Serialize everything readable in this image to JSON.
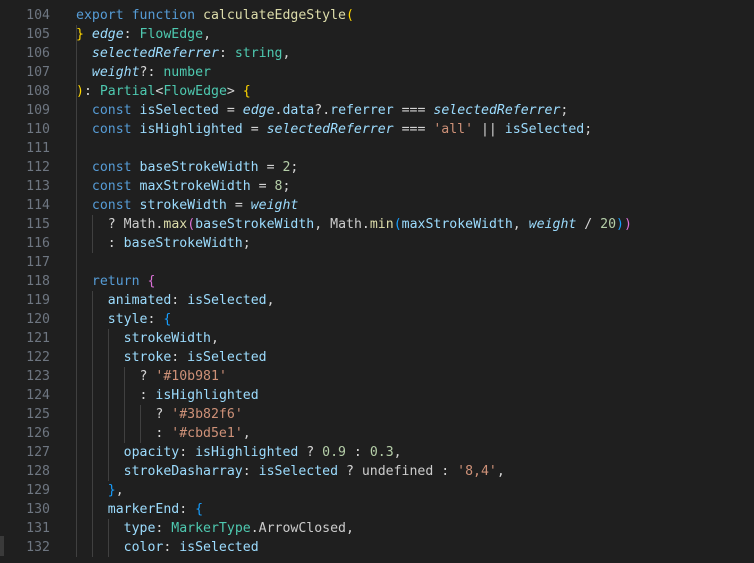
{
  "editor": {
    "first_line_partial": "}",
    "lines": [
      {
        "num": "104",
        "tokens": [
          {
            "t": "export ",
            "c": "kw"
          },
          {
            "t": "function ",
            "c": "kw"
          },
          {
            "t": "calculateEdgeStyle",
            "c": "fn"
          },
          {
            "t": "(",
            "c": "b1"
          }
        ]
      },
      {
        "num": "105",
        "tokens": [
          {
            "t": "  "
          },
          {
            "t": "edge",
            "c": "param"
          },
          {
            "t": ": ",
            "c": "op"
          },
          {
            "t": "FlowEdge",
            "c": "type"
          },
          {
            "t": ",",
            "c": "op"
          }
        ]
      },
      {
        "num": "106",
        "tokens": [
          {
            "t": "  "
          },
          {
            "t": "selectedReferrer",
            "c": "param"
          },
          {
            "t": ": ",
            "c": "op"
          },
          {
            "t": "string",
            "c": "type"
          },
          {
            "t": ",",
            "c": "op"
          }
        ]
      },
      {
        "num": "107",
        "tokens": [
          {
            "t": "  "
          },
          {
            "t": "weight",
            "c": "param"
          },
          {
            "t": "?: ",
            "c": "op"
          },
          {
            "t": "number",
            "c": "type"
          }
        ]
      },
      {
        "num": "108",
        "tokens": [
          {
            "t": ")",
            "c": "b1"
          },
          {
            "t": ": ",
            "c": "op"
          },
          {
            "t": "Partial",
            "c": "type"
          },
          {
            "t": "<",
            "c": "op"
          },
          {
            "t": "FlowEdge",
            "c": "type"
          },
          {
            "t": "> ",
            "c": "op"
          },
          {
            "t": "{",
            "c": "b1"
          }
        ]
      },
      {
        "num": "109",
        "tokens": [
          {
            "t": "  "
          },
          {
            "t": "const ",
            "c": "kw"
          },
          {
            "t": "isSelected",
            "c": "var"
          },
          {
            "t": " = ",
            "c": "op"
          },
          {
            "t": "edge",
            "c": "param"
          },
          {
            "t": ".",
            "c": "op"
          },
          {
            "t": "data",
            "c": "var"
          },
          {
            "t": "?.",
            "c": "op"
          },
          {
            "t": "referrer",
            "c": "var"
          },
          {
            "t": " === ",
            "c": "op"
          },
          {
            "t": "selectedReferrer",
            "c": "param"
          },
          {
            "t": ";",
            "c": "op"
          }
        ]
      },
      {
        "num": "110",
        "tokens": [
          {
            "t": "  "
          },
          {
            "t": "const ",
            "c": "kw"
          },
          {
            "t": "isHighlighted",
            "c": "var"
          },
          {
            "t": " = ",
            "c": "op"
          },
          {
            "t": "selectedReferrer",
            "c": "param"
          },
          {
            "t": " === ",
            "c": "op"
          },
          {
            "t": "'all'",
            "c": "str"
          },
          {
            "t": " || ",
            "c": "op"
          },
          {
            "t": "isSelected",
            "c": "var"
          },
          {
            "t": ";",
            "c": "op"
          }
        ]
      },
      {
        "num": "111",
        "tokens": []
      },
      {
        "num": "112",
        "tokens": [
          {
            "t": "  "
          },
          {
            "t": "const ",
            "c": "kw"
          },
          {
            "t": "baseStrokeWidth",
            "c": "var"
          },
          {
            "t": " = ",
            "c": "op"
          },
          {
            "t": "2",
            "c": "num"
          },
          {
            "t": ";",
            "c": "op"
          }
        ]
      },
      {
        "num": "113",
        "tokens": [
          {
            "t": "  "
          },
          {
            "t": "const ",
            "c": "kw"
          },
          {
            "t": "maxStrokeWidth",
            "c": "var"
          },
          {
            "t": " = ",
            "c": "op"
          },
          {
            "t": "8",
            "c": "num"
          },
          {
            "t": ";",
            "c": "op"
          }
        ]
      },
      {
        "num": "114",
        "tokens": [
          {
            "t": "  "
          },
          {
            "t": "const ",
            "c": "kw"
          },
          {
            "t": "strokeWidth",
            "c": "var"
          },
          {
            "t": " = ",
            "c": "op"
          },
          {
            "t": "weight",
            "c": "param"
          }
        ]
      },
      {
        "num": "115",
        "tokens": [
          {
            "t": "    "
          },
          {
            "t": "? ",
            "c": "tern"
          },
          {
            "t": "Math",
            "c": "plain"
          },
          {
            "t": ".",
            "c": "op"
          },
          {
            "t": "max",
            "c": "fn"
          },
          {
            "t": "(",
            "c": "b2"
          },
          {
            "t": "baseStrokeWidth",
            "c": "var"
          },
          {
            "t": ", ",
            "c": "op"
          },
          {
            "t": "Math",
            "c": "plain"
          },
          {
            "t": ".",
            "c": "op"
          },
          {
            "t": "min",
            "c": "fn"
          },
          {
            "t": "(",
            "c": "b3"
          },
          {
            "t": "maxStrokeWidth",
            "c": "var"
          },
          {
            "t": ", ",
            "c": "op"
          },
          {
            "t": "weight",
            "c": "param"
          },
          {
            "t": " / ",
            "c": "op"
          },
          {
            "t": "20",
            "c": "num"
          },
          {
            "t": ")",
            "c": "b3"
          },
          {
            "t": ")",
            "c": "b2"
          }
        ]
      },
      {
        "num": "116",
        "tokens": [
          {
            "t": "    "
          },
          {
            "t": ": ",
            "c": "tern"
          },
          {
            "t": "baseStrokeWidth",
            "c": "var"
          },
          {
            "t": ";",
            "c": "op"
          }
        ]
      },
      {
        "num": "117",
        "tokens": []
      },
      {
        "num": "118",
        "tokens": [
          {
            "t": "  "
          },
          {
            "t": "return ",
            "c": "kw"
          },
          {
            "t": "{",
            "c": "b2"
          }
        ]
      },
      {
        "num": "119",
        "tokens": [
          {
            "t": "    "
          },
          {
            "t": "animated",
            "c": "prop"
          },
          {
            "t": ": ",
            "c": "op"
          },
          {
            "t": "isSelected",
            "c": "var"
          },
          {
            "t": ",",
            "c": "op"
          }
        ]
      },
      {
        "num": "120",
        "tokens": [
          {
            "t": "    "
          },
          {
            "t": "style",
            "c": "prop"
          },
          {
            "t": ": ",
            "c": "op"
          },
          {
            "t": "{",
            "c": "b3"
          }
        ]
      },
      {
        "num": "121",
        "tokens": [
          {
            "t": "      "
          },
          {
            "t": "strokeWidth",
            "c": "prop"
          },
          {
            "t": ",",
            "c": "op"
          }
        ]
      },
      {
        "num": "122",
        "tokens": [
          {
            "t": "      "
          },
          {
            "t": "stroke",
            "c": "prop"
          },
          {
            "t": ": ",
            "c": "op"
          },
          {
            "t": "isSelected",
            "c": "var"
          }
        ]
      },
      {
        "num": "123",
        "tokens": [
          {
            "t": "        "
          },
          {
            "t": "? ",
            "c": "tern"
          },
          {
            "t": "'#10b981'",
            "c": "str"
          }
        ]
      },
      {
        "num": "124",
        "tokens": [
          {
            "t": "        "
          },
          {
            "t": ": ",
            "c": "tern"
          },
          {
            "t": "isHighlighted",
            "c": "var"
          }
        ]
      },
      {
        "num": "125",
        "tokens": [
          {
            "t": "          "
          },
          {
            "t": "? ",
            "c": "tern"
          },
          {
            "t": "'#3b82f6'",
            "c": "str"
          }
        ]
      },
      {
        "num": "126",
        "tokens": [
          {
            "t": "          "
          },
          {
            "t": ": ",
            "c": "tern"
          },
          {
            "t": "'#cbd5e1'",
            "c": "str"
          },
          {
            "t": ",",
            "c": "op"
          }
        ]
      },
      {
        "num": "127",
        "tokens": [
          {
            "t": "      "
          },
          {
            "t": "opacity",
            "c": "prop"
          },
          {
            "t": ": ",
            "c": "op"
          },
          {
            "t": "isHighlighted",
            "c": "var"
          },
          {
            "t": " ? ",
            "c": "tern"
          },
          {
            "t": "0.9",
            "c": "num"
          },
          {
            "t": " : ",
            "c": "tern"
          },
          {
            "t": "0.3",
            "c": "num"
          },
          {
            "t": ",",
            "c": "op"
          }
        ]
      },
      {
        "num": "128",
        "tokens": [
          {
            "t": "      "
          },
          {
            "t": "strokeDasharray",
            "c": "prop"
          },
          {
            "t": ": ",
            "c": "op"
          },
          {
            "t": "isSelected",
            "c": "var"
          },
          {
            "t": " ? ",
            "c": "tern"
          },
          {
            "t": "undefined",
            "c": "plain"
          },
          {
            "t": " : ",
            "c": "tern"
          },
          {
            "t": "'8,4'",
            "c": "str"
          },
          {
            "t": ",",
            "c": "op"
          }
        ]
      },
      {
        "num": "129",
        "tokens": [
          {
            "t": "    "
          },
          {
            "t": "}",
            "c": "b3"
          },
          {
            "t": ",",
            "c": "op"
          }
        ]
      },
      {
        "num": "130",
        "tokens": [
          {
            "t": "    "
          },
          {
            "t": "markerEnd",
            "c": "prop"
          },
          {
            "t": ": ",
            "c": "op"
          },
          {
            "t": "{",
            "c": "b3"
          }
        ]
      },
      {
        "num": "131",
        "tokens": [
          {
            "t": "      "
          },
          {
            "t": "type",
            "c": "prop"
          },
          {
            "t": ": ",
            "c": "op"
          },
          {
            "t": "MarkerType",
            "c": "type"
          },
          {
            "t": ".",
            "c": "op"
          },
          {
            "t": "ArrowClosed",
            "c": "plain"
          },
          {
            "t": ",",
            "c": "op"
          }
        ]
      },
      {
        "num": "132",
        "tokens": [
          {
            "t": "      "
          },
          {
            "t": "color",
            "c": "prop"
          },
          {
            "t": ": ",
            "c": "op"
          },
          {
            "t": "isSelected",
            "c": "var"
          }
        ]
      }
    ]
  },
  "theme": {
    "background": "#1f1f1f",
    "line_number_color": "#6e7681",
    "keyword": "#569cd6",
    "function": "#dcdcaa",
    "variable": "#9cdcfe",
    "type": "#4ec9b0",
    "string": "#ce9178",
    "number": "#b5cea8"
  }
}
